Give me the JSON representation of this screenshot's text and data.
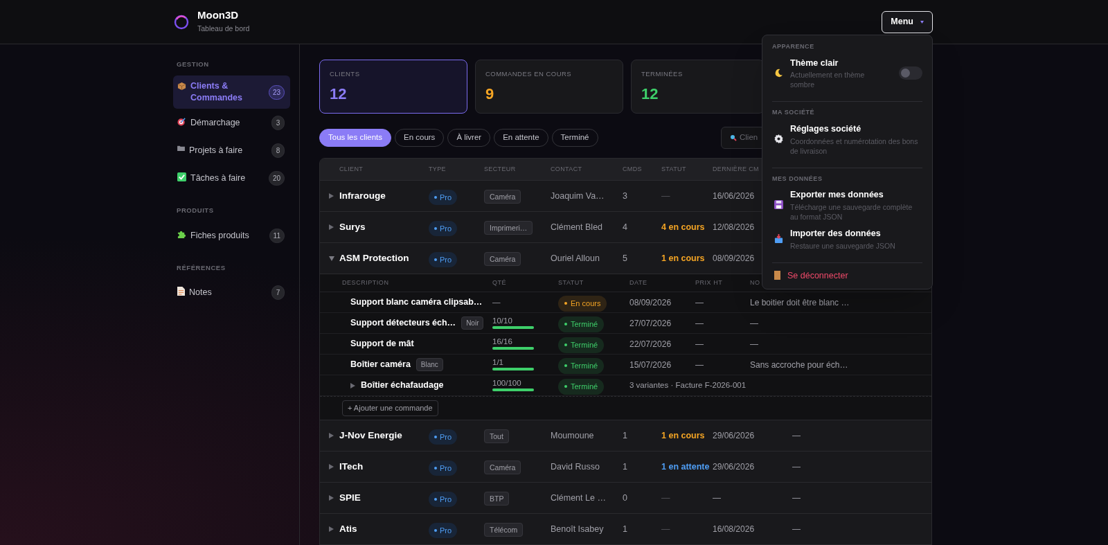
{
  "app": {
    "name": "Moon3D",
    "subtitle": "Tableau de bord"
  },
  "menu_button": {
    "label": "Menu",
    "expanded": true
  },
  "sidebar": {
    "sections": [
      {
        "title": "GESTION",
        "items": [
          {
            "label": "Clients & Commandes",
            "count": "23",
            "selected": true
          },
          {
            "label": "Démarchage",
            "count": "3",
            "selected": false
          },
          {
            "label": "Projets à faire",
            "count": "8",
            "selected": false
          },
          {
            "label": "Tâches à faire",
            "count": "20",
            "selected": false
          }
        ]
      },
      {
        "title": "PRODUITS",
        "items": [
          {
            "label": "Fiches produits",
            "count": "11",
            "selected": false
          }
        ]
      },
      {
        "title": "RÉFÉRENCES",
        "items": [
          {
            "label": "Notes",
            "count": "7",
            "selected": false
          }
        ]
      }
    ]
  },
  "stats": [
    {
      "label": "CLIENTS",
      "value": "12",
      "color": "#8b7cf6",
      "selected": true
    },
    {
      "label": "COMMANDES EN COURS",
      "value": "9",
      "color": "#f5a524",
      "selected": false
    },
    {
      "label": "TERMINÉES",
      "value": "12",
      "color": "#3ecf6a",
      "selected": false
    }
  ],
  "filters": [
    {
      "label": "Tous les clients",
      "selected": true
    },
    {
      "label": "En cours",
      "selected": false
    },
    {
      "label": "À livrer",
      "selected": false
    },
    {
      "label": "En attente",
      "selected": false
    },
    {
      "label": "Terminé",
      "selected": false
    }
  ],
  "search": {
    "placeholder": "Clien"
  },
  "table": {
    "columns": [
      "CLIENT",
      "TYPE",
      "SECTEUR",
      "CONTACT",
      "CMDS",
      "STATUT",
      "DERNIÈRE CM"
    ],
    "rows": [
      {
        "name": "Infrarouge",
        "expanded": false,
        "type": "Pro",
        "sector": "Caméra",
        "contact": "Joaquim Va…",
        "orders": "3",
        "status": "—",
        "kind": "none",
        "last_order": "16/06/2026"
      },
      {
        "name": "Surys",
        "expanded": false,
        "type": "Pro",
        "sector": "Imprimeri…",
        "contact": "Clément Bled",
        "orders": "4",
        "status": "4 en cours",
        "kind": "in_progress",
        "last_order": "12/08/2026"
      },
      {
        "name": "ASM Protection",
        "expanded": true,
        "type": "Pro",
        "sector": "Caméra",
        "contact": "Ouriel Alloun",
        "orders": "5",
        "status": "1 en cours",
        "kind": "in_progress",
        "last_order": "08/09/2026",
        "details": {
          "columns": [
            "DESCRIPTION",
            "QTÉ",
            "STATUT",
            "DATE",
            "PRIX HT",
            "NO"
          ],
          "orders": [
            {
              "kind": "item",
              "description": "Support blanc caméra clipsab…",
              "quantity": "—",
              "status": "En cours",
              "color": "#f5a524",
              "date": "08/09/2026",
              "price": "—",
              "notes": "Le boitier doit être blanc …"
            },
            {
              "kind": "item",
              "description": "Support détecteurs éch…",
              "tag": "Noir",
              "quantity": "10/10",
              "level": 1,
              "status": "Terminé",
              "color": "#3ecf6a",
              "date": "27/07/2026",
              "price": "—",
              "notes": "—"
            },
            {
              "kind": "item",
              "description": "Support de mât",
              "quantity": "16/16",
              "level": 1,
              "status": "Terminé",
              "color": "#3ecf6a",
              "date": "22/07/2026",
              "price": "—",
              "notes": "—"
            },
            {
              "kind": "item",
              "description": "Boîtier caméra",
              "tag": "Blanc",
              "quantity": "1/1",
              "level": 1,
              "status": "Terminé",
              "color": "#3ecf6a",
              "date": "15/07/2026",
              "price": "—",
              "notes": "Sans accroche pour éch…"
            },
            {
              "kind": "group",
              "description": "Boîtier échafaudage",
              "expanded": false,
              "quantity": "100/100",
              "level": 1,
              "status": "Terminé",
              "color": "#3ecf6a",
              "summary": "3 variantes · Facture F-2026-001"
            }
          ],
          "add_button": "+ Ajouter une commande"
        }
      },
      {
        "name": "J-Nov Energie",
        "expanded": false,
        "type": "Pro",
        "sector": "Tout",
        "contact": "Moumoune",
        "orders": "1",
        "status": "1 en cours",
        "kind": "in_progress",
        "last_order": "29/06/2026",
        "column_8": "—"
      },
      {
        "name": "ITech",
        "expanded": false,
        "type": "Pro",
        "sector": "Caméra",
        "contact": "David Russo",
        "orders": "1",
        "status": "1 en attente",
        "kind": "waiting",
        "last_order": "29/06/2026",
        "column_8": "—"
      },
      {
        "name": "SPIE",
        "expanded": false,
        "type": "Pro",
        "sector": "BTP",
        "contact": "Clément Le …",
        "orders": "0",
        "status": "—",
        "kind": "none",
        "last_order": "—",
        "column_8": "—"
      },
      {
        "name": "Atis",
        "expanded": false,
        "type": "Pro",
        "sector": "Télécom",
        "contact": "Benoît Isabey",
        "orders": "1",
        "status": "—",
        "kind": "none",
        "last_order": "16/08/2026",
        "column_8": "—"
      }
    ]
  },
  "menu": {
    "sections": [
      {
        "title": "APPARENCE",
        "items": [
          {
            "kind": "toggle",
            "title": "Thème clair",
            "description": "Actuellement en thème sombre",
            "on": false
          }
        ]
      },
      {
        "title": "MA SOCIÉTÉ",
        "items": [
          {
            "kind": "link",
            "title": "Réglages société",
            "description": "Coordonnées et numérotation des bons de livraison"
          }
        ]
      },
      {
        "title": "MES DONNÉES",
        "items": [
          {
            "kind": "link",
            "title": "Exporter mes données",
            "description": "Télécharge une sauvegarde complète au format JSON"
          },
          {
            "kind": "link",
            "title": "Importer des données",
            "description": "Restaure une sauvegarde JSON"
          }
        ]
      }
    ],
    "logout": "Se déconnecter"
  }
}
